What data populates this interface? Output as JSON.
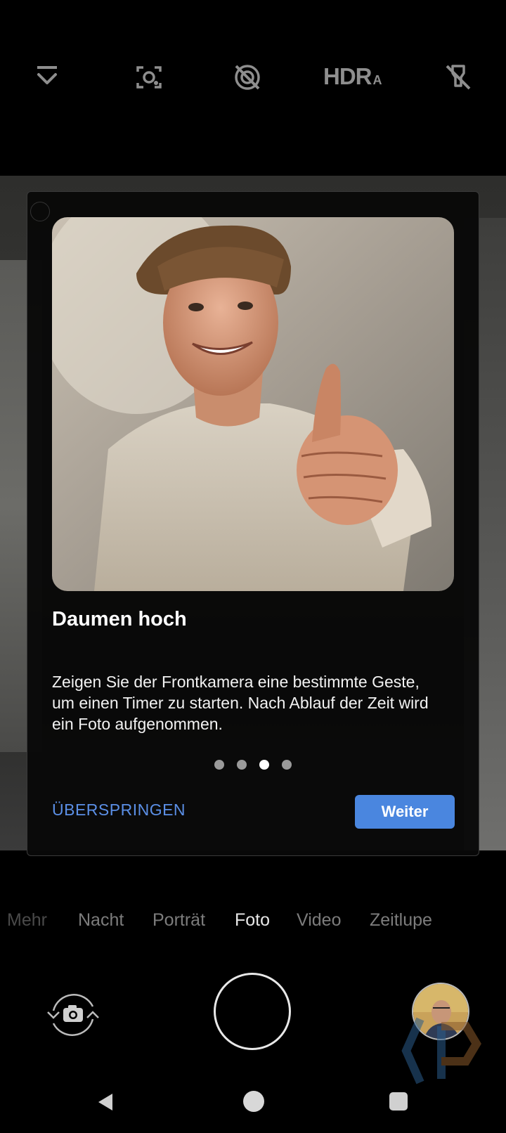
{
  "toolbar": {
    "icons": [
      "collapse-icon",
      "lens-icon",
      "motion-off-icon",
      "hdr-auto-icon",
      "flash-off-icon"
    ],
    "hdr_label": "HDR",
    "hdr_suffix": "A"
  },
  "dialog": {
    "title": "Daumen hoch",
    "body": "Zeigen Sie der Frontkamera eine bestimmte Geste, um einen Timer zu starten. Nach Ablauf der Zeit wird ein Foto aufgenommen.",
    "page_count": 4,
    "active_page": 3,
    "skip_label": "ÜBERSPRINGEN",
    "next_label": "Weiter"
  },
  "modes": {
    "items": [
      "Mehr",
      "Nacht",
      "Porträt",
      "Foto",
      "Video",
      "Zeitlupe"
    ],
    "selected": "Foto"
  },
  "colors": {
    "accent": "#4a86df",
    "link": "#5b8fe6"
  }
}
